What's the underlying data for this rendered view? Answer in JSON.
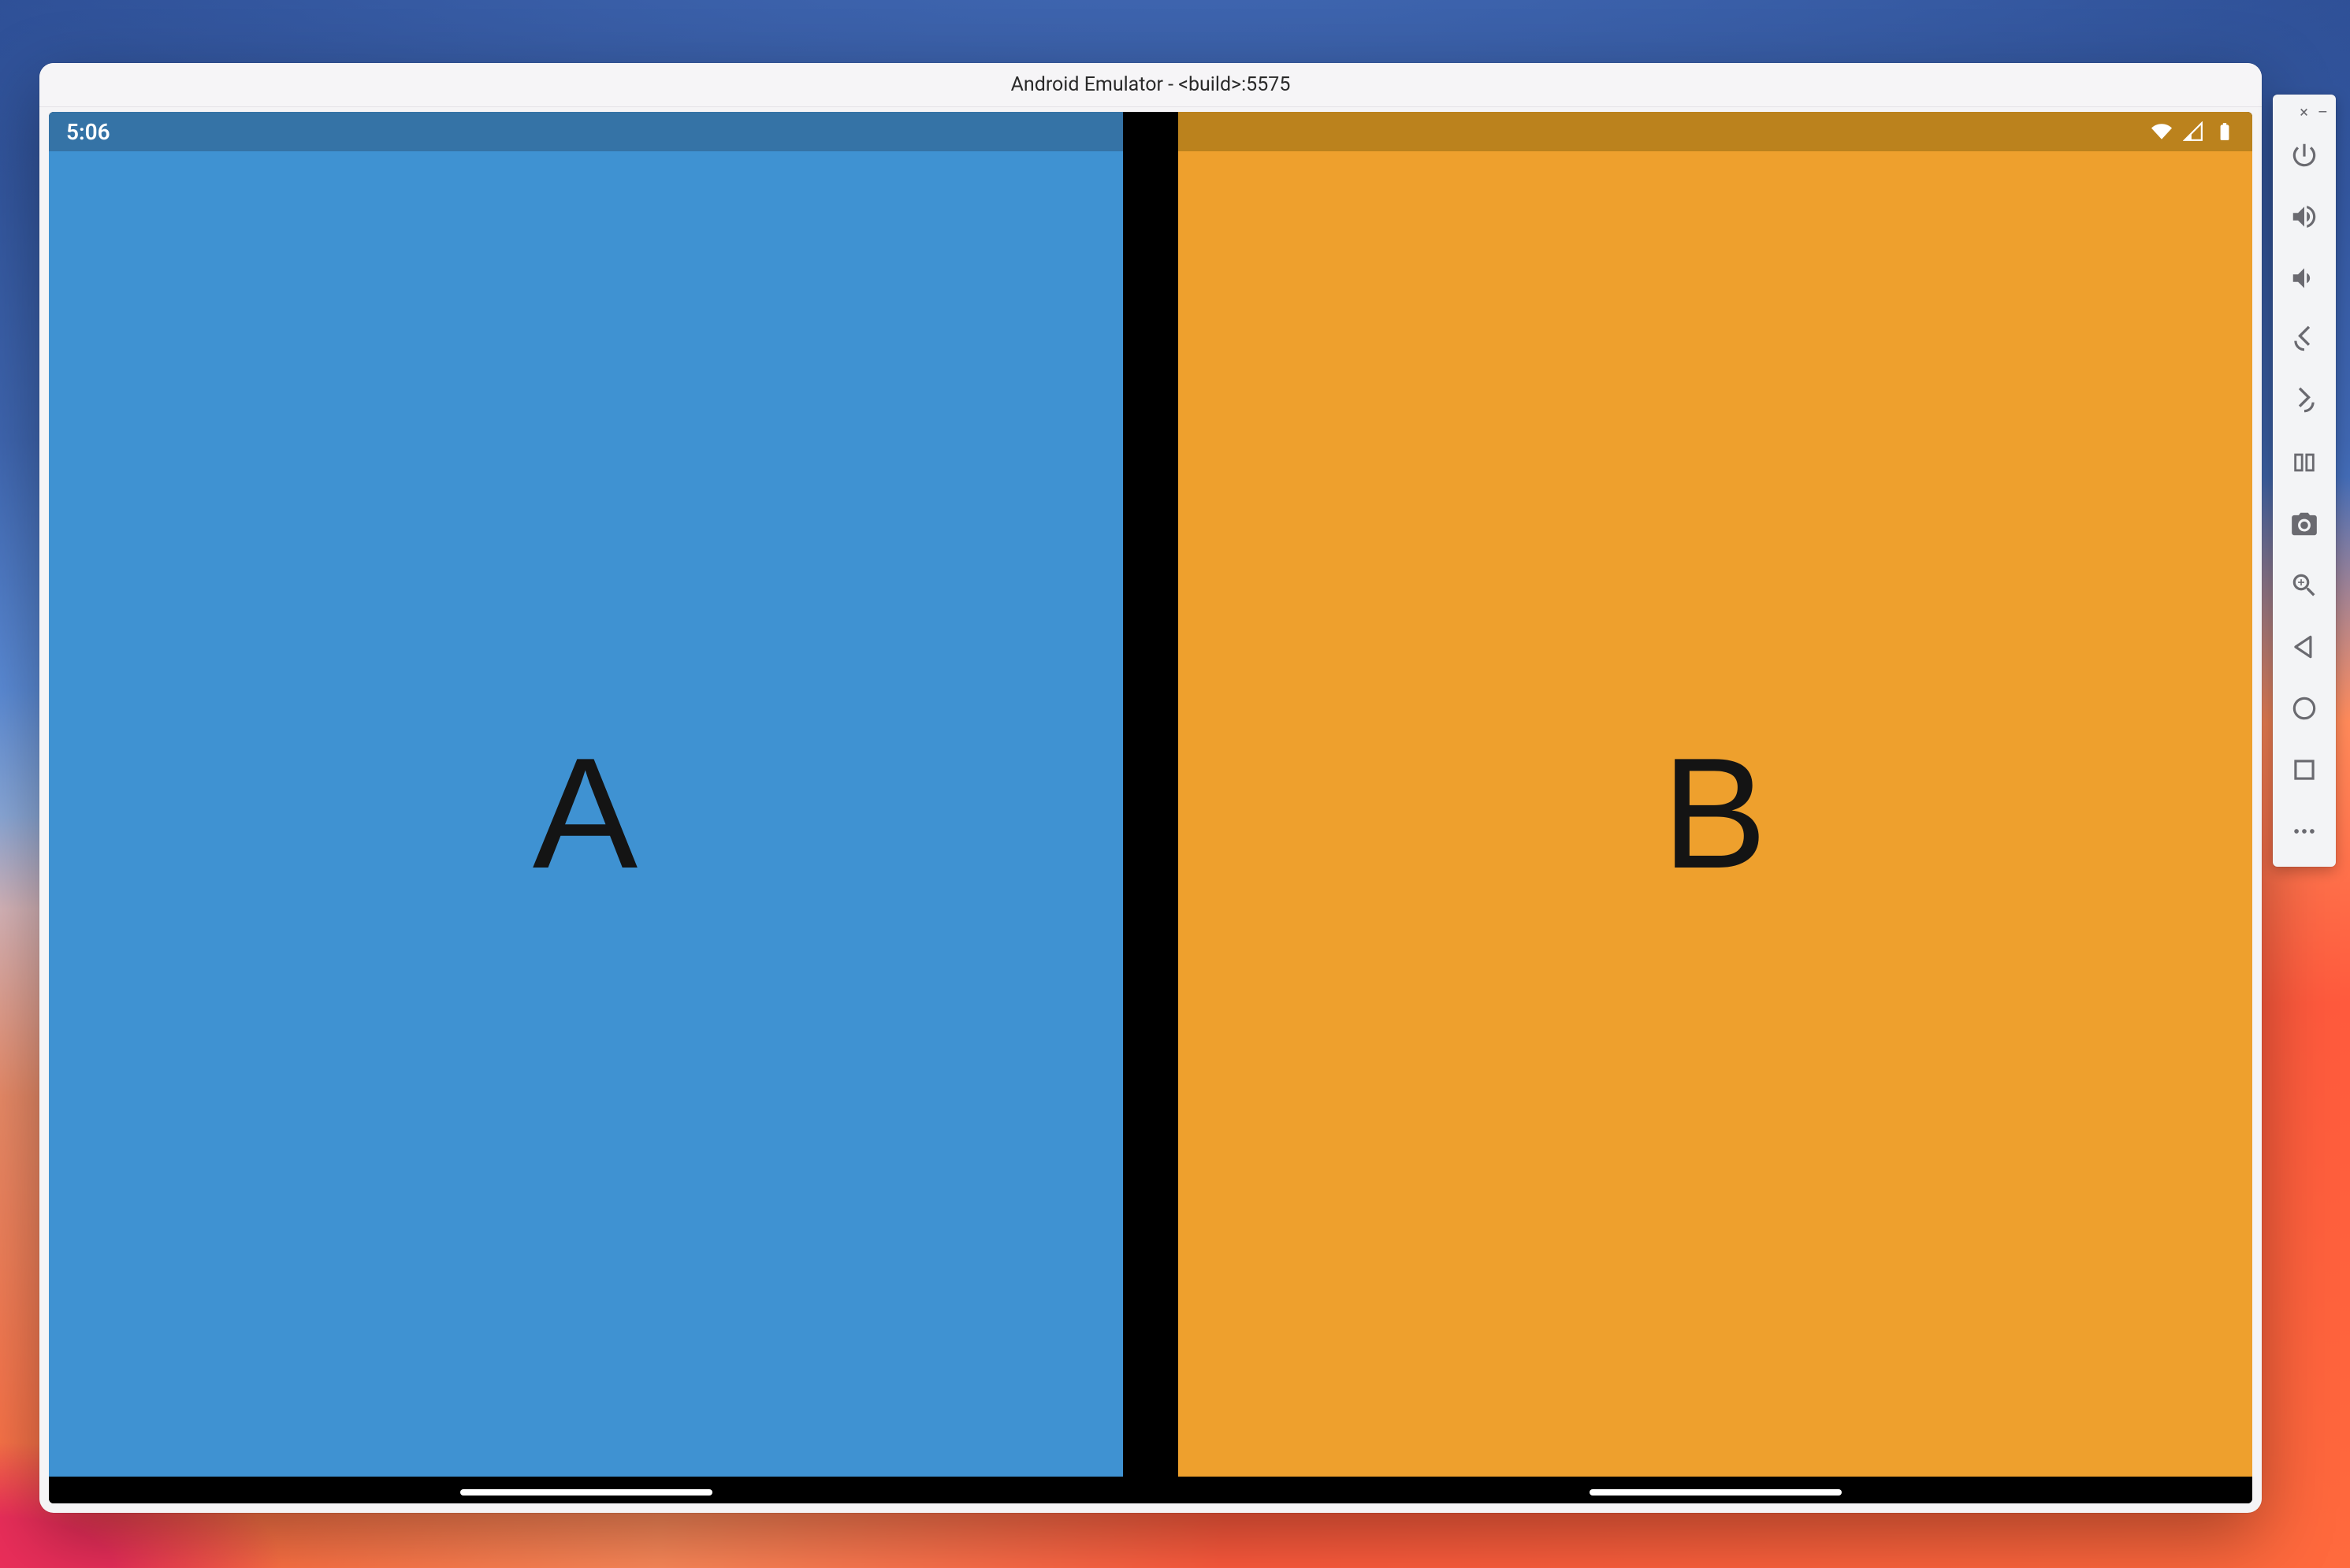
{
  "wallpaper": {
    "name": "macos-big-sur"
  },
  "window": {
    "title": "Android Emulator - <build>:5575"
  },
  "statusbar": {
    "time": "5:06",
    "icons": {
      "wifi": "wifi-icon",
      "signal": "cellular-signal-icon",
      "battery": "battery-full-icon"
    }
  },
  "panes": {
    "left": {
      "label": "A",
      "bg": "#3f92d2",
      "status_bg": "#3573a6"
    },
    "right": {
      "label": "B",
      "bg": "#eea02d",
      "status_bg": "#bb821d"
    }
  },
  "sidebar": {
    "window_controls": {
      "close": "×",
      "minimize": "–"
    },
    "buttons": [
      {
        "name": "power-icon",
        "label": "Power"
      },
      {
        "name": "volume-up-icon",
        "label": "Volume Up"
      },
      {
        "name": "volume-down-icon",
        "label": "Volume Down"
      },
      {
        "name": "rotate-left-icon",
        "label": "Rotate Left"
      },
      {
        "name": "rotate-right-icon",
        "label": "Rotate Right"
      },
      {
        "name": "fold-icon",
        "label": "Fold"
      },
      {
        "name": "screenshot-icon",
        "label": "Take Screenshot"
      },
      {
        "name": "zoom-icon",
        "label": "Zoom"
      },
      {
        "name": "back-icon",
        "label": "Back"
      },
      {
        "name": "home-icon",
        "label": "Home"
      },
      {
        "name": "overview-icon",
        "label": "Overview"
      },
      {
        "name": "more-icon",
        "label": "More"
      }
    ]
  }
}
